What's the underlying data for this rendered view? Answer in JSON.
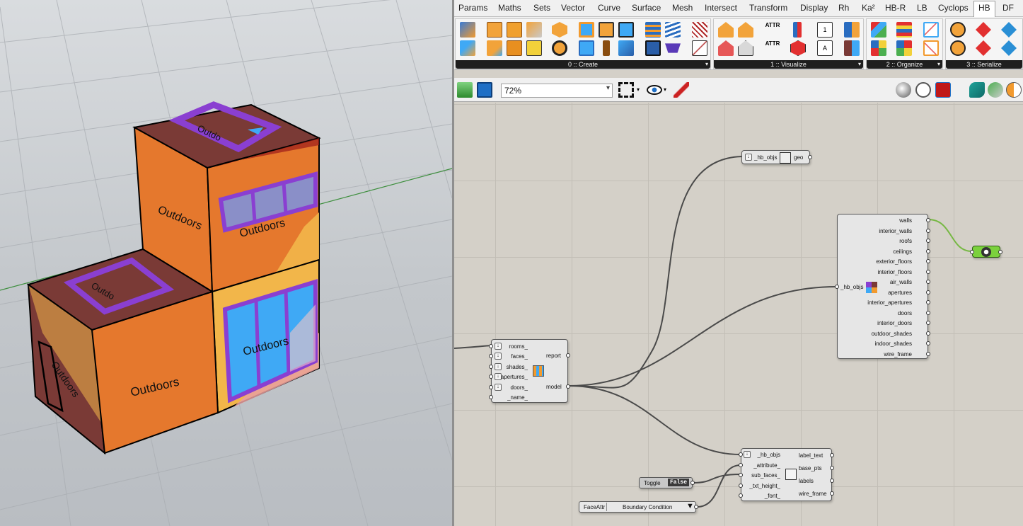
{
  "viewport": {
    "face_labels": [
      "Outdoors",
      "Outdoors",
      "Outdoors",
      "Outdoors",
      "Outdoors",
      "Outdo",
      "Outdo"
    ]
  },
  "tabs": [
    "Params",
    "Maths",
    "Sets",
    "Vector",
    "Curve",
    "Surface",
    "Mesh",
    "Intersect",
    "Transform",
    "Display",
    "Rh",
    "Ka²",
    "HB-R",
    "LB",
    "Cyclops",
    "HB",
    "DF"
  ],
  "active_tab": "HB",
  "ribbon_groups": [
    "0 :: Create",
    "1 :: Visualize",
    "2 :: Organize",
    "3 :: Serialize"
  ],
  "ribbon_text": {
    "attr1": "ATTR",
    "attr2": "ATTR"
  },
  "toolbar": {
    "zoom": "72%"
  },
  "components": {
    "geo_comp": {
      "input": "_hb_objs",
      "output": "geo"
    },
    "decompose": {
      "input": "_hb_objs",
      "outputs": [
        "walls",
        "interior_walls",
        "roofs",
        "ceilings",
        "exterior_floors",
        "interior_floors",
        "air_walls",
        "apertures",
        "interior_apertures",
        "doors",
        "interior_doors",
        "outdoor_shades",
        "indoor_shades",
        "wire_frame"
      ]
    },
    "model": {
      "inputs": [
        "rooms_",
        "faces_",
        "shades_",
        "apertures_",
        "doors_",
        "_name_"
      ],
      "outputs": [
        "report",
        "model"
      ]
    },
    "label_comp": {
      "inputs": [
        "_hb_objs",
        "_attribute_",
        "sub_faces_",
        "_txt_height_",
        "_font_"
      ],
      "outputs": [
        "label_text",
        "base_pts",
        "labels",
        "wire_frame"
      ]
    },
    "toggle": {
      "label": "Toggle",
      "value": "False"
    },
    "face_attr": {
      "label": "FaceAttr",
      "value": "Boundary Condition"
    }
  },
  "colors": {
    "wire": "#4a4a4a",
    "wire_selected": "#76b843",
    "panel_bg": "#d4d0c8",
    "face_orange": "#e5782d",
    "roof_maroon": "#7a3a36",
    "aperture_blue": "#3fa9f5",
    "frame_purple": "#8a3fd1"
  }
}
